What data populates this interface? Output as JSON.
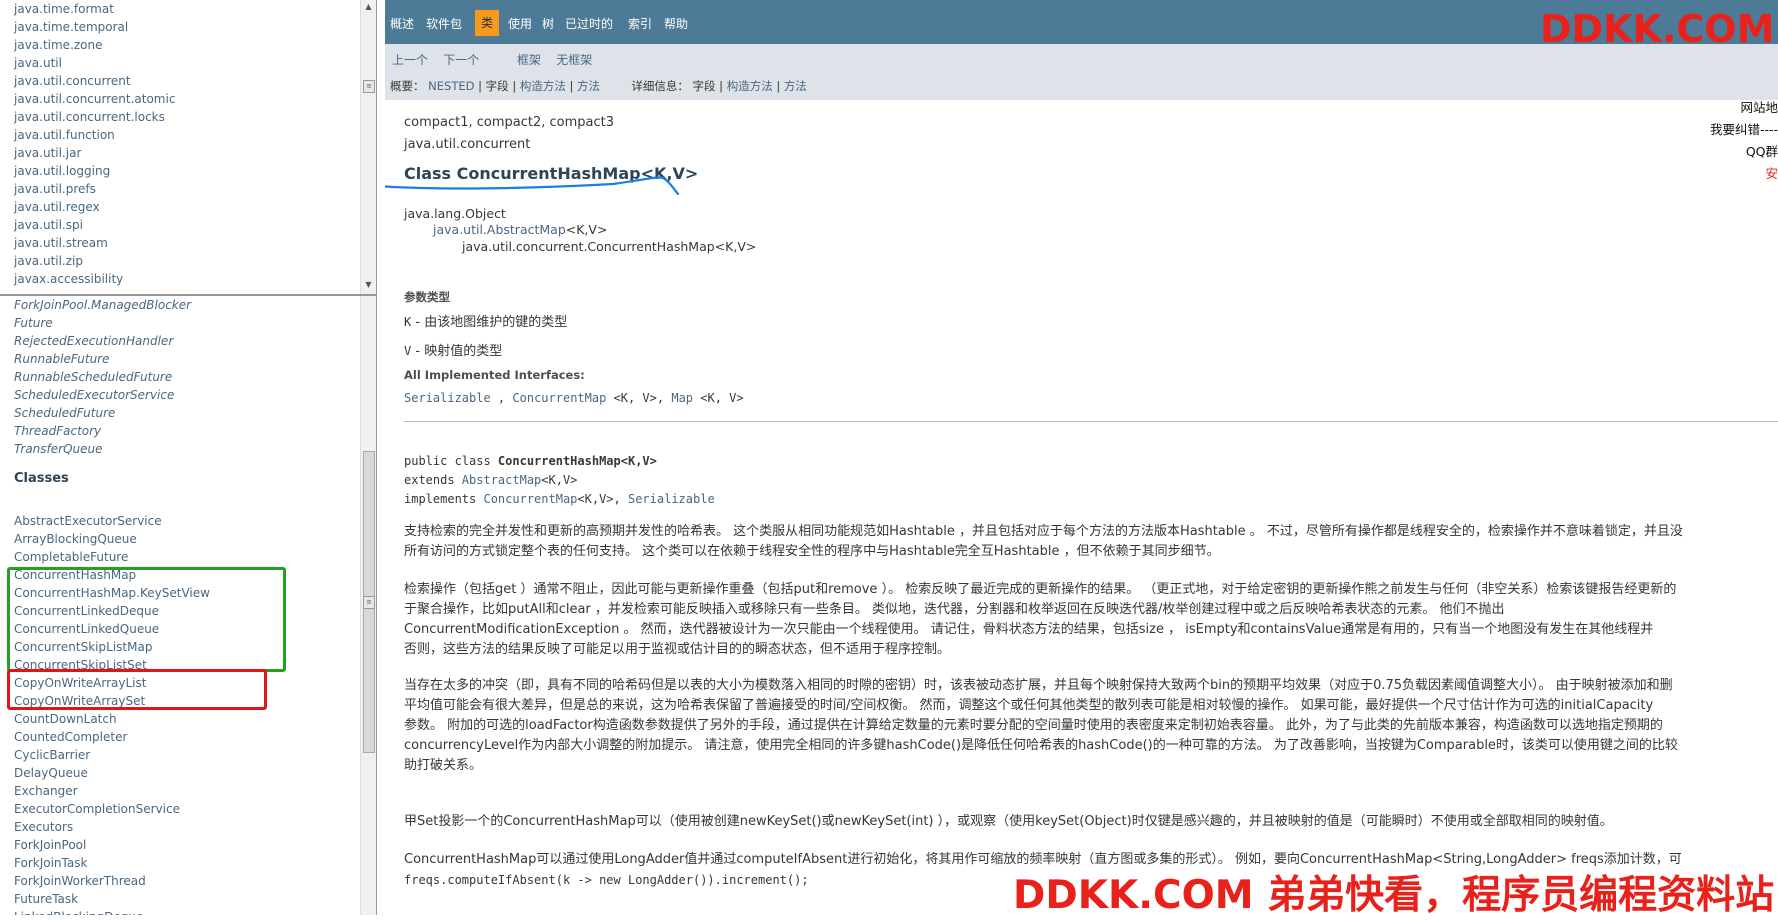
{
  "package_frame": {
    "packages": [
      "java.time.format",
      "java.time.temporal",
      "java.time.zone",
      "java.util",
      "java.util.concurrent",
      "java.util.concurrent.atomic",
      "java.util.concurrent.locks",
      "java.util.function",
      "java.util.jar",
      "java.util.logging",
      "java.util.prefs",
      "java.util.regex",
      "java.util.spi",
      "java.util.stream",
      "java.util.zip",
      "javax.accessibility"
    ]
  },
  "class_frame": {
    "interfaces": [
      "ForkJoinPool.ManagedBlocker",
      "Future",
      "RejectedExecutionHandler",
      "RunnableFuture",
      "RunnableScheduledFuture",
      "ScheduledExecutorService",
      "ScheduledFuture",
      "ThreadFactory",
      "TransferQueue"
    ],
    "classes_heading": "Classes",
    "classes": [
      "AbstractExecutorService",
      "ArrayBlockingQueue",
      "CompletableFuture",
      "ConcurrentHashMap",
      "ConcurrentHashMap.KeySetView",
      "ConcurrentLinkedDeque",
      "ConcurrentLinkedQueue",
      "ConcurrentSkipListMap",
      "ConcurrentSkipListSet",
      "CopyOnWriteArrayList",
      "CopyOnWriteArraySet",
      "CountDownLatch",
      "CountedCompleter",
      "CyclicBarrier",
      "DelayQueue",
      "Exchanger",
      "ExecutorCompletionService",
      "Executors",
      "ForkJoinPool",
      "ForkJoinTask",
      "ForkJoinWorkerThread",
      "FutureTask",
      "LinkedBlockingDeque"
    ]
  },
  "topnav": {
    "items": [
      "概述",
      "软件包",
      "类",
      "使用",
      "树",
      "已过时的",
      "索引",
      "帮助"
    ],
    "active": "类"
  },
  "subnav": {
    "prev": "上一个",
    "next": "下一个",
    "frames": "框架",
    "no_frames": "无框架",
    "summary_label": "概要：",
    "summary_nested": "NESTED",
    "summary_field": "字段",
    "summary_constr": "构造方法",
    "summary_method": "方法",
    "detail_label": "详细信息：",
    "detail_field": "字段",
    "detail_constr": "构造方法",
    "detail_method": "方法",
    "pipe": "|"
  },
  "watermarks": {
    "top": "DDKK.COM",
    "bottom": "DDKK.COM 弟弟快看，程序员编程资料站"
  },
  "side_notes": [
    "网站地",
    "我要纠错----",
    "QQ群",
    "安"
  ],
  "header": {
    "profiles": "compact1, compact2, compact3",
    "package": "java.util.concurrent",
    "title": "Class ConcurrentHashMap<K,V>",
    "hier1": "java.lang.Object",
    "hier2_link": "java.util.AbstractMap",
    "hier2_suffix": "<K,V>",
    "hier3": "java.util.concurrent.ConcurrentHashMap<K,V>"
  },
  "type_params": {
    "heading": "参数类型",
    "k_name": "K",
    "k_desc": " - 由该地图维护的键的类型",
    "v_name": "V",
    "v_desc": " - 映射值的类型"
  },
  "interfaces": {
    "heading": "All Implemented Interfaces:",
    "serializable": "Serializable",
    "sep1": " , ",
    "concurrentmap": "ConcurrentMap",
    "kv1": " <K, V>, ",
    "map": "Map",
    "kv2": " <K, V>"
  },
  "signature": {
    "l1_pre": "public class ",
    "l1_name": "ConcurrentHashMap<K,V>",
    "l2_pre": "extends ",
    "l2_link": "AbstractMap",
    "l2_suf": "<K,V>",
    "l3_pre": "implements ",
    "l3_link1": "ConcurrentMap",
    "l3_mid": "<K,V>, ",
    "l3_link2": "Serializable"
  },
  "paragraphs": {
    "p1_line1": "支持检索的完全并发性和更新的高预期并发性的哈希表。 这个类服从相同功能规范如Hashtable ，并且包括对应于每个方法的方法版本Hashtable 。 不过，尽管所有操作都是线程安全的，检索操作并不意味着锁定，并且没",
    "p1_line2": "所有访问的方式锁定整个表的任何支持。 这个类可以在依赖于线程安全性的程序中与Hashtable完全互Hashtable ，但不依赖于其同步细节。",
    "p2_line1": "检索操作（包括get ）通常不阻止，因此可能与更新操作重叠（包括put和remove ）。 检索反映了最近完成的更新操作的结果。 （更正式地，对于给定密钥的更新操作熊之前发生与任何（非空关系）检索该键报告经更新的",
    "p2_line2": "于聚合操作，比如putAll和clear ，并发检索可能反映插入或移除只有一些条目。 类似地，迭代器，分割器和枚举返回在反映迭代器/枚举创建过程中或之后反映哈希表状态的元素。 他们不抛出",
    "p2_line3": "ConcurrentModificationException 。 然而，迭代器被设计为一次只能由一个线程使用。 请记住，骨料状态方法的结果，包括size ， isEmpty和containsValue通常是有用的，只有当一个地图没有发生在其他线程并",
    "p2_line4": "否则，这些方法的结果反映了可能足以用于监视或估计目的的瞬态状态，但不适用于程序控制。",
    "p3_line1": "当存在太多的冲突（即，具有不同的哈希码但是以表的大小为模数落入相同的时隙的密钥）时，该表被动态扩展，并且每个映射保持大致两个bin的预期平均效果（对应于0.75负载因素阈值调整大小）。 由于映射被添加和删",
    "p3_line2": "平均值可能会有很大差异，但是总的来说，这为哈希表保留了普遍接受的时间/空间权衡。 然而，调整这个或任何其他类型的散列表可能是相对较慢的操作。 如果可能，最好提供一个尺寸估计作为可选的initialCapacity",
    "p3_line3": "参数。 附加的可选的loadFactor构造函数参数提供了另外的手段，通过提供在计算给定数量的元素时要分配的空间量时使用的表密度来定制初始表容量。 此外，为了与此类的先前版本兼容，构造函数可以选地指定预期的",
    "p3_line4": "concurrencyLevel作为内部大小调整的附加提示。 请注意，使用完全相同的许多键hashCode()是降低任何哈希表的hashCode()的一种可靠的方法。 为了改善影响，当按键为Comparable时，该类可以使用键之间的比较",
    "p3_line5": "助打破关系。",
    "p4_line1": "甲Set投影一个的ConcurrentHashMap可以（使用被创建newKeySet()或newKeySet(int) ），或观察（使用keySet(Object)时仅键是感兴趣的，并且被映射的值是（可能瞬时）不使用或全部取相同的映射值。",
    "p5_line1": "ConcurrentHashMap可以通过使用LongAdder值并通过computeIfAbsent进行初始化，将其用作可缩放的频率映射（直方图或多集的形式）。 例如，要向ConcurrentHashMap<String,LongAdder> freqs添加计数，可",
    "p5_line2": "freqs.computeIfAbsent(k -> new LongAdder()).increment();"
  },
  "colors": {
    "nav_bg": "#4d7a97",
    "nav_active": "#f8981d",
    "subnav_bg": "#dee3e9",
    "link": "#4a6782",
    "watermark": "#e8221b",
    "green_box": "#1fa31f",
    "red_box": "#e01616",
    "annotation": "#1a7fe0"
  }
}
